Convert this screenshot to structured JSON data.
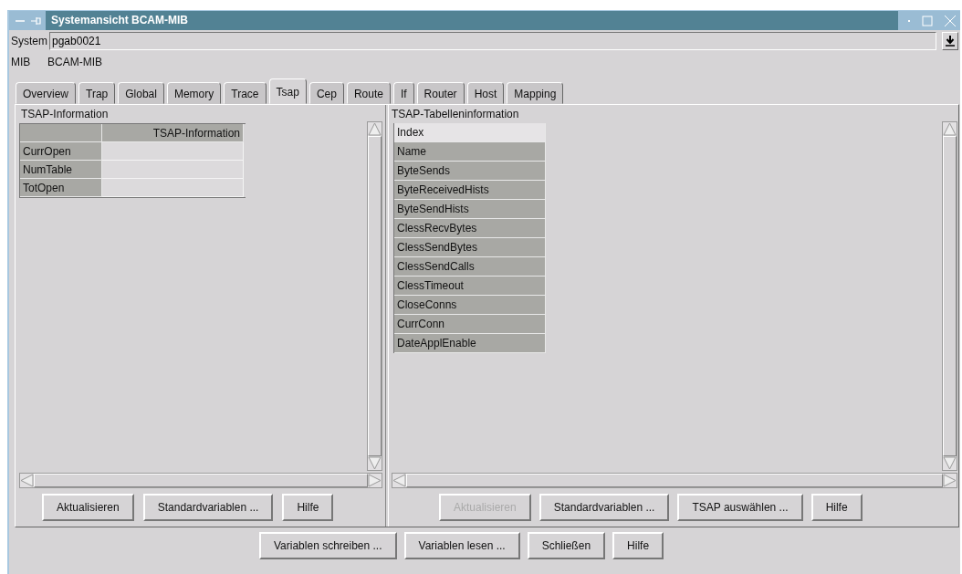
{
  "window": {
    "title": "Systemansicht BCAM-MIB"
  },
  "system": {
    "label": "System",
    "value": "pgab0021"
  },
  "mib": {
    "label": "MIB",
    "value": "BCAM-MIB"
  },
  "tabs": [
    {
      "label": "Overview",
      "selected": false
    },
    {
      "label": "Trap",
      "selected": false
    },
    {
      "label": "Global",
      "selected": false
    },
    {
      "label": "Memory",
      "selected": false
    },
    {
      "label": "Trace",
      "selected": false
    },
    {
      "label": "Tsap",
      "selected": true
    },
    {
      "label": "Cep",
      "selected": false
    },
    {
      "label": "Route",
      "selected": false
    },
    {
      "label": "If",
      "selected": false
    },
    {
      "label": "Router",
      "selected": false
    },
    {
      "label": "Host",
      "selected": false
    },
    {
      "label": "Mapping",
      "selected": false
    }
  ],
  "left_panel": {
    "title": "TSAP-Information",
    "table": {
      "columns": [
        "TSAP-Information"
      ],
      "rows": [
        "CurrOpen",
        "NumTable",
        "TotOpen"
      ]
    },
    "buttons": [
      {
        "label": "Aktualisieren",
        "disabled": false
      },
      {
        "label": "Standardvariablen ...",
        "disabled": false
      },
      {
        "label": "Hilfe",
        "disabled": false
      }
    ]
  },
  "right_panel": {
    "title": "TSAP-Tabelleninformation",
    "items": [
      {
        "label": "Index",
        "selected": true
      },
      {
        "label": "Name",
        "selected": false
      },
      {
        "label": "ByteSends",
        "selected": false
      },
      {
        "label": "ByteReceivedHists",
        "selected": false
      },
      {
        "label": "ByteSendHists",
        "selected": false
      },
      {
        "label": "ClessRecvBytes",
        "selected": false
      },
      {
        "label": "ClessSendBytes",
        "selected": false
      },
      {
        "label": "ClessSendCalls",
        "selected": false
      },
      {
        "label": "ClessTimeout",
        "selected": false
      },
      {
        "label": "CloseConns",
        "selected": false
      },
      {
        "label": "CurrConn",
        "selected": false
      },
      {
        "label": "DateApplEnable",
        "selected": false
      }
    ],
    "buttons": [
      {
        "label": "Aktualisieren",
        "disabled": true
      },
      {
        "label": "Standardvariablen ...",
        "disabled": false
      },
      {
        "label": "TSAP auswählen ...",
        "disabled": false
      },
      {
        "label": "Hilfe",
        "disabled": false
      }
    ]
  },
  "buttons": [
    {
      "label": "Variablen schreiben ...",
      "disabled": false
    },
    {
      "label": "Variablen lesen ...",
      "disabled": false
    },
    {
      "label": "Schließen",
      "disabled": false
    },
    {
      "label": "Hilfe",
      "disabled": false
    }
  ]
}
